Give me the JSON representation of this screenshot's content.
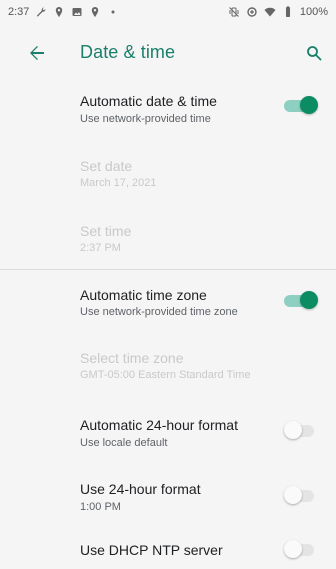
{
  "status_bar": {
    "time": "2:37",
    "battery": "100%",
    "left_icons": [
      "wrench-icon",
      "location-pin-icon",
      "image-icon",
      "location-pin-icon",
      "dot-icon"
    ],
    "right_icons": [
      "vibrate-off-icon",
      "data-saver-icon",
      "wifi-icon",
      "battery-icon"
    ]
  },
  "app_bar": {
    "title": "Date & time",
    "accent_color": "#1a7f6b"
  },
  "settings": {
    "auto_date_time": {
      "title": "Automatic date & time",
      "summary": "Use network-provided time",
      "enabled": true
    },
    "set_date": {
      "title": "Set date",
      "summary": "March 17, 2021"
    },
    "set_time": {
      "title": "Set time",
      "summary": "2:37 PM"
    },
    "auto_time_zone": {
      "title": "Automatic time zone",
      "summary": "Use network-provided time zone",
      "enabled": true
    },
    "select_time_zone": {
      "title": "Select time zone",
      "summary": "GMT-05:00 Eastern Standard Time"
    },
    "auto_24h": {
      "title": "Automatic 24-hour format",
      "summary": "Use locale default",
      "enabled": false
    },
    "use_24h": {
      "title": "Use 24-hour format",
      "summary": "1:00 PM",
      "enabled": false
    },
    "dhcp_ntp": {
      "title": "Use DHCP NTP server",
      "enabled": false
    }
  }
}
